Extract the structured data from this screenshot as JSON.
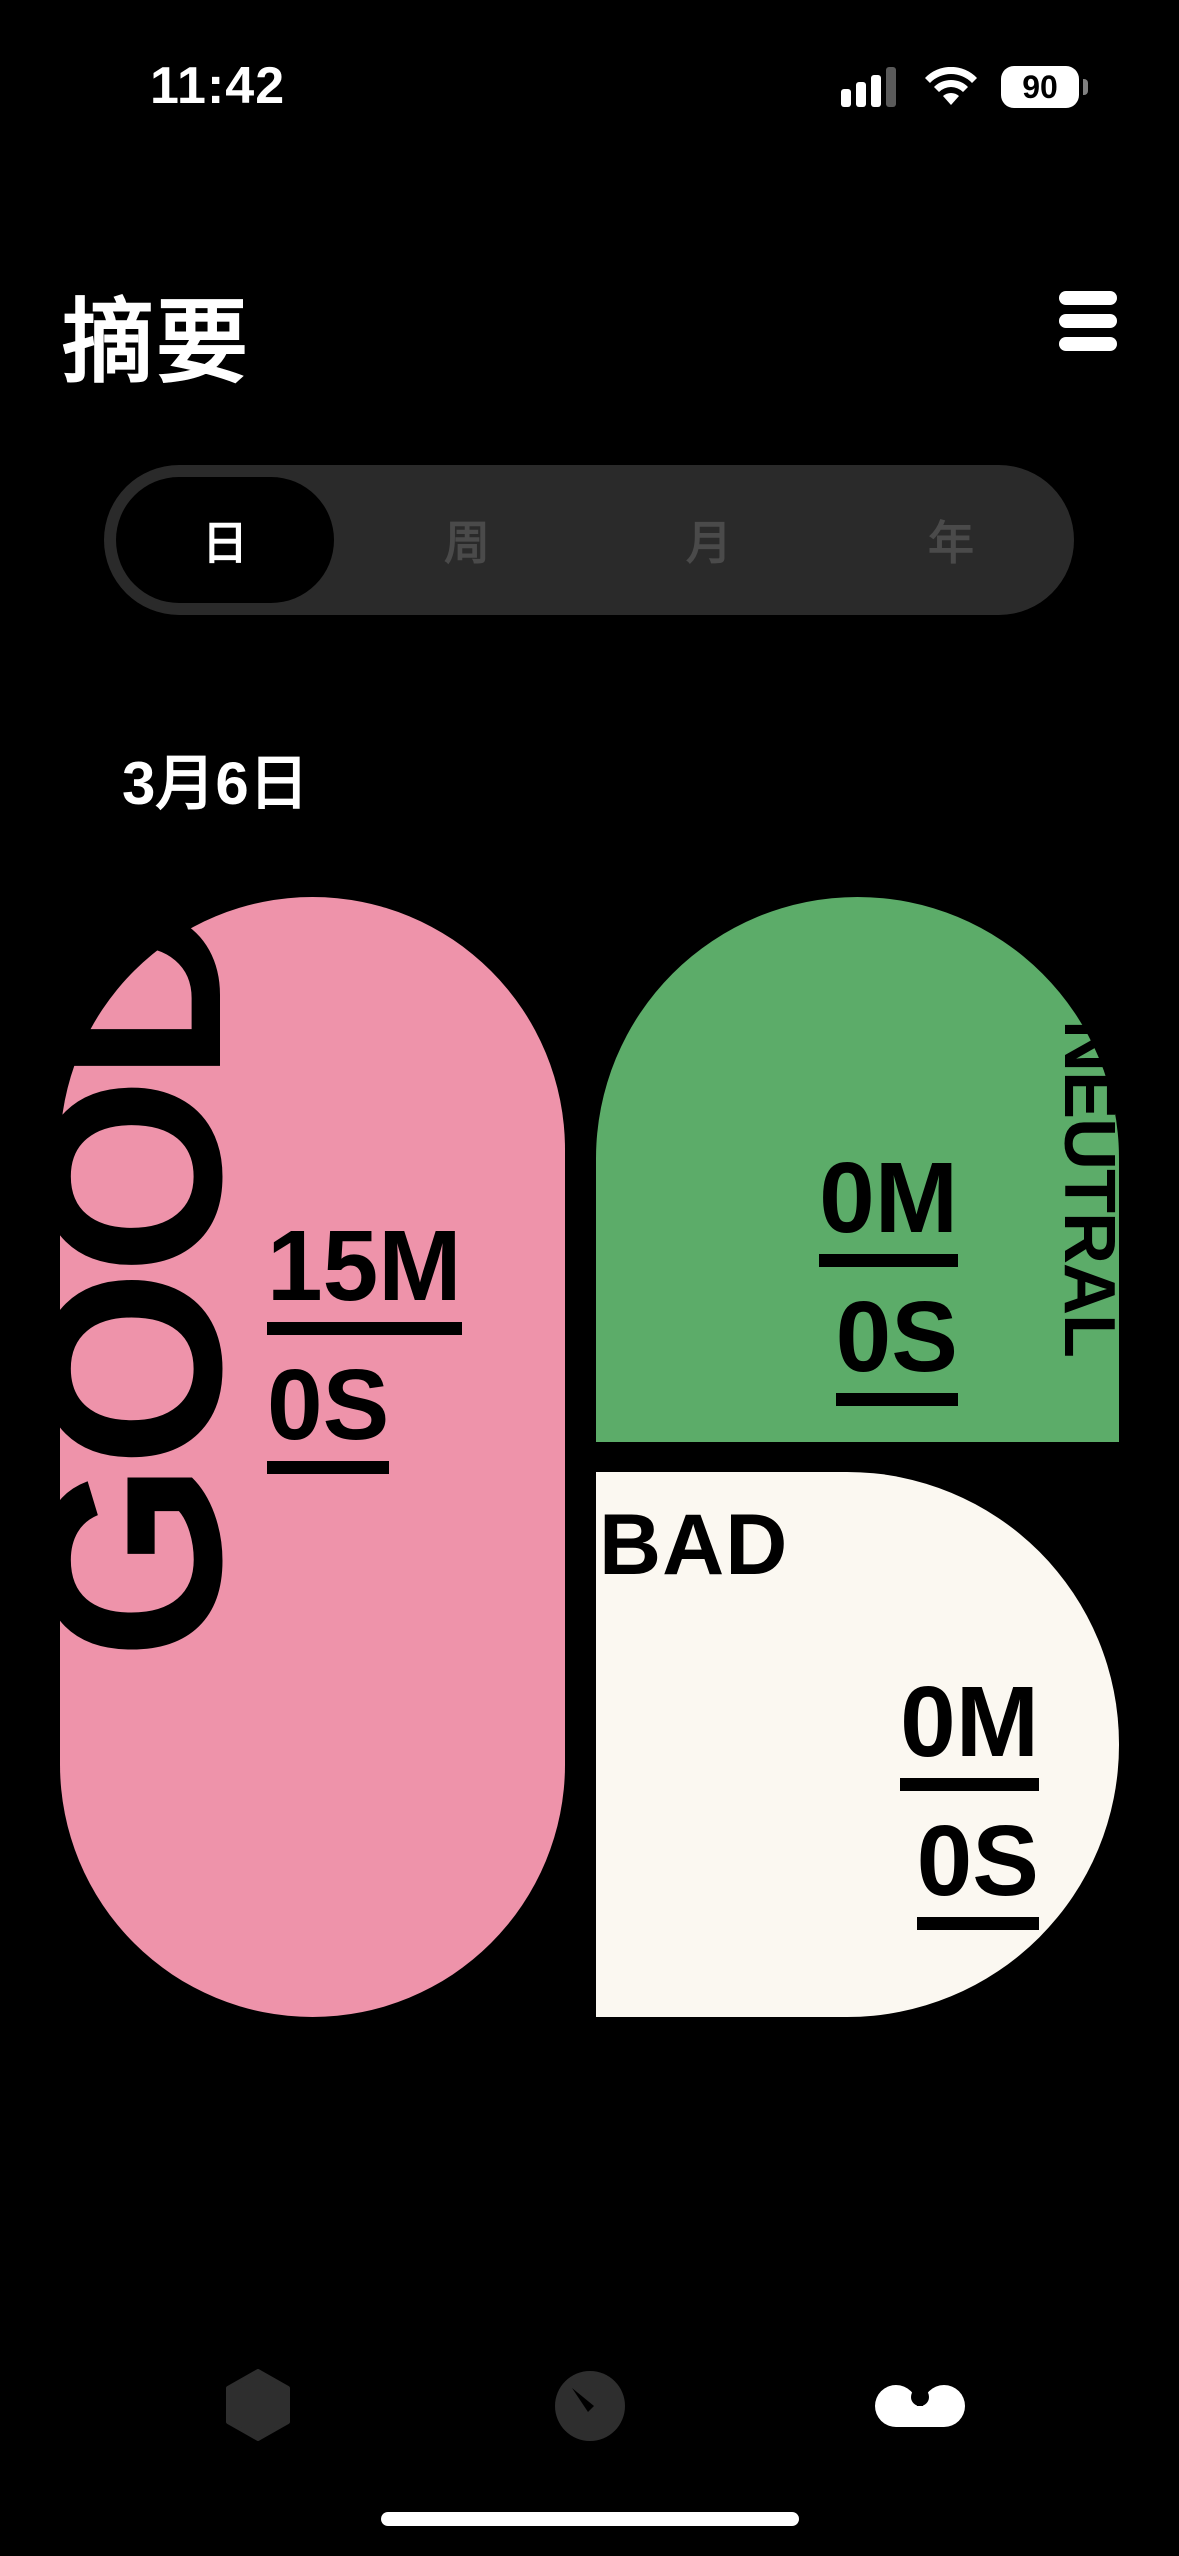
{
  "status_bar": {
    "time": "11:42",
    "battery": "90",
    "icons": [
      "signal-icon",
      "wifi-icon",
      "battery-icon"
    ]
  },
  "header": {
    "title": "摘要",
    "menu_icon": "menu-icon"
  },
  "tabs": [
    {
      "label": "日",
      "selected": true
    },
    {
      "label": "周",
      "selected": false
    },
    {
      "label": "月",
      "selected": false
    },
    {
      "label": "年",
      "selected": false
    }
  ],
  "date": "3月6日",
  "moods": {
    "good": {
      "label": "GOOD",
      "minutes": "15M",
      "seconds": "0S",
      "color": "#ee93aa"
    },
    "neutral": {
      "label": "NEUTRAL",
      "minutes": "0M",
      "seconds": "0S",
      "color": "#5cac69"
    },
    "bad": {
      "label": "BAD",
      "minutes": "0M",
      "seconds": "0S",
      "color": "#fbf8f1"
    }
  },
  "bottom_nav": [
    {
      "icon": "hexagon-icon",
      "active": false
    },
    {
      "icon": "gauge-icon",
      "active": false
    },
    {
      "icon": "voicemail-icon",
      "active": true
    }
  ],
  "colors": {
    "background": "#000000",
    "segment_bg": "#2a2a2a",
    "inactive": "#4a4a4a"
  }
}
